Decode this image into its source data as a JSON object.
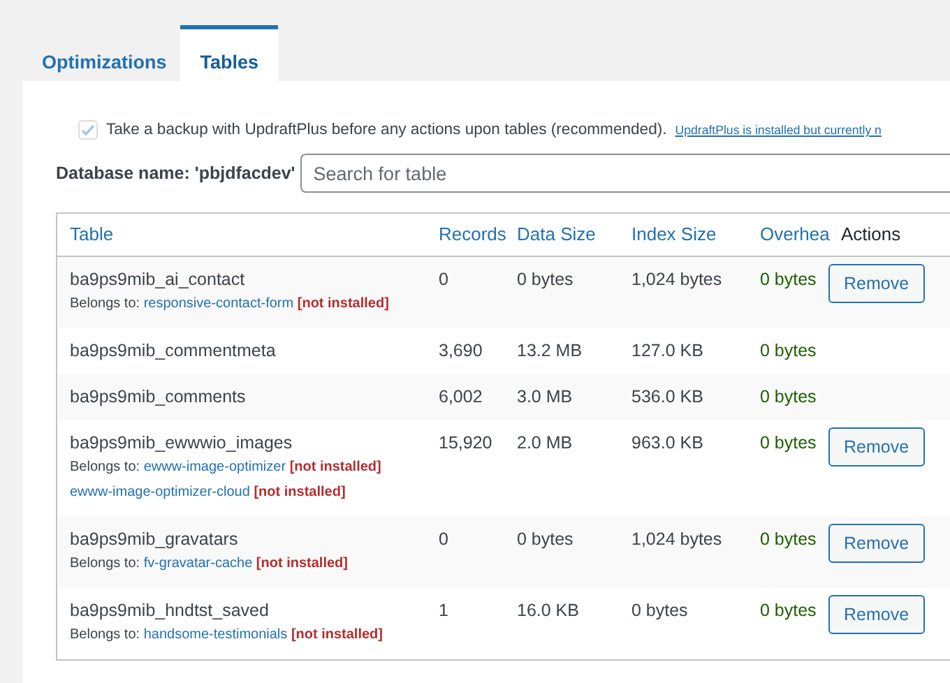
{
  "tabs": [
    {
      "label": "Optimizations",
      "selected": false
    },
    {
      "label": "Tables",
      "selected": true
    }
  ],
  "backup": {
    "checked": true,
    "disabled": true,
    "label": "Take a backup with UpdraftPlus before any actions upon tables (recommended).",
    "link": "UpdraftPlus is installed but currently n"
  },
  "database_label": "Database name: 'pbjdfacdev'",
  "search": {
    "placeholder": "Search for table"
  },
  "table": {
    "columns": [
      "Table",
      "Records",
      "Data Size",
      "Index Size",
      "Overhea",
      "Actions"
    ],
    "rows": [
      {
        "name": "ba9ps9mib_ai_contact",
        "records": "0",
        "data_size": "0 bytes",
        "index_size": "1,024 bytes",
        "overhead": "0 bytes",
        "action": "Remove",
        "belongs": {
          "label": "Belongs to:",
          "plugins": [
            {
              "name": "responsive-contact-form",
              "status": "[not installed]"
            }
          ]
        }
      },
      {
        "name": "ba9ps9mib_commentmeta",
        "records": "3,690",
        "data_size": "13.2 MB",
        "index_size": "127.0 KB",
        "overhead": "0 bytes"
      },
      {
        "name": "ba9ps9mib_comments",
        "records": "6,002",
        "data_size": "3.0 MB",
        "index_size": "536.0 KB",
        "overhead": "0 bytes"
      },
      {
        "name": "ba9ps9mib_ewwwio_images",
        "records": "15,920",
        "data_size": "2.0 MB",
        "index_size": "963.0 KB",
        "overhead": "0 bytes",
        "action": "Remove",
        "belongs": {
          "label": "Belongs to:",
          "plugins": [
            {
              "name": "ewww-image-optimizer",
              "status": "[not installed]"
            },
            {
              "name": "ewww-image-optimizer-cloud",
              "status": "[not installed]"
            }
          ]
        }
      },
      {
        "name": "ba9ps9mib_gravatars",
        "records": "0",
        "data_size": "0 bytes",
        "index_size": "1,024 bytes",
        "overhead": "0 bytes",
        "action": "Remove",
        "belongs": {
          "label": "Belongs to:",
          "plugins": [
            {
              "name": "fv-gravatar-cache",
              "status": "[not installed]"
            }
          ]
        }
      },
      {
        "name": "ba9ps9mib_hndtst_saved",
        "records": "1",
        "data_size": "16.0 KB",
        "index_size": "0 bytes",
        "overhead": "0 bytes",
        "action": "Remove",
        "belongs": {
          "label": "Belongs to:",
          "plugins": [
            {
              "name": "handsome-testimonials",
              "status": "[not installed]"
            }
          ]
        }
      }
    ]
  }
}
